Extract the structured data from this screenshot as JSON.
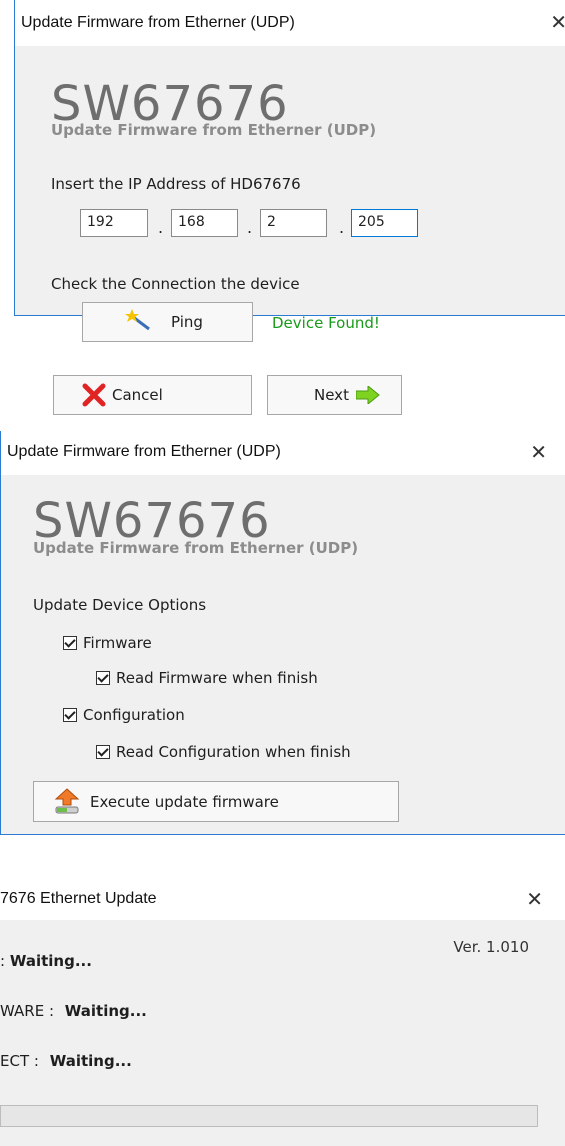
{
  "dialog1": {
    "title": "Update Firmware from Etherner (UDP)",
    "close": "✕",
    "app_name": "SW67676",
    "subtitle": "Update Firmware from Etherner (UDP)",
    "ip_label": "Insert the IP Address of  HD67676",
    "ip": [
      "192",
      "168",
      "2",
      "205"
    ],
    "ip_separator": ".",
    "check_label": "Check the Connection the device",
    "ping_label": "Ping",
    "status": "Device Found!",
    "cancel_label": "Cancel",
    "next_label": "Next"
  },
  "dialog2": {
    "title": "Update Firmware from Etherner (UDP)",
    "close": "✕",
    "app_name": "SW67676",
    "subtitle": "Update Firmware from Etherner (UDP)",
    "options_label": "Update Device Options",
    "firmware": {
      "label": "Firmware",
      "checked": true
    },
    "read_firmware": {
      "label": "Read Firmware when finish",
      "checked": true
    },
    "configuration": {
      "label": "Configuration",
      "checked": true
    },
    "read_configuration": {
      "label": "Read Configuration when finish",
      "checked": true
    },
    "execute_label": "Execute update firmware"
  },
  "dialog3": {
    "title": "7676 Ethernet Update",
    "close": "✕",
    "version": "Ver. 1.010",
    "line1_label": ":",
    "line1_value": "Waiting...",
    "line2_label": "WARE :",
    "line2_value": "Waiting...",
    "line3_label": "ECT :",
    "line3_value": "Waiting...",
    "progress": 0
  },
  "colors": {
    "status_green": "#1a9a1a",
    "window_bg": "#f0f0f0",
    "accent_blue": "#0078d7"
  }
}
